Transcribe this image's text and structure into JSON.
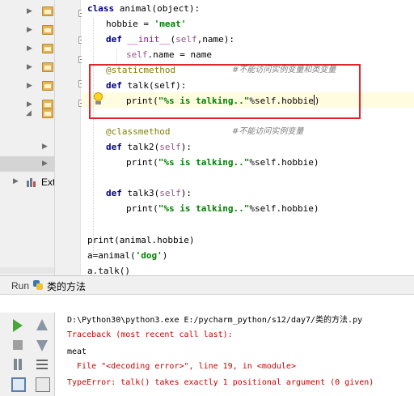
{
  "project_tree": {
    "folders": [
      "",
      "",
      "",
      "",
      "",
      "",
      ""
    ],
    "external_label": "Ext"
  },
  "colors": {
    "keyword": "#000080",
    "string": "#008000",
    "self": "#94558d",
    "decorator": "#808000",
    "comment": "#808080",
    "error": "#cc0000",
    "highlight_box": "#e0262a"
  },
  "editor": {
    "lines": [
      {
        "kw": "class ",
        "rest": "animal(object):"
      },
      {
        "name": "hobbie",
        "op": " = ",
        "str": "'meat'"
      },
      {
        "kw": "def ",
        "magic": "__init__",
        "open": "(",
        "self": "self",
        "rest": ",name):"
      },
      {
        "self": "self",
        "rest": ".name = name"
      },
      {
        "deco": "@staticmethod",
        "comment": "#不能访问实例变量和类变量"
      },
      {
        "kw": "def ",
        "rest": "talk(self):"
      },
      {
        "call": "print(",
        "str": "\"%s is talking..\"",
        "rest": "%self.hobbie",
        "close": ")"
      },
      {
        "deco": "@classmethod",
        "comment": "#不能访问实例变量"
      },
      {
        "kw": "def ",
        "rest": "talk2(",
        "self": "self",
        "close": "):"
      },
      {
        "call": "print(",
        "str": "\"%s is talking..\"",
        "rest": "%self.hobbie)"
      },
      {
        "kw": "def ",
        "rest": "talk3(",
        "self": "self",
        "close": "):"
      },
      {
        "call": "print(",
        "str": "\"%s is talking..\"",
        "rest": "%self.hobbie)"
      },
      {
        "rest": "print(animal.hobbie)"
      },
      {
        "pre": "a=animal(",
        "str": "'dog'",
        "close": ")"
      },
      {
        "rest": "a.talk()"
      }
    ]
  },
  "run_panel": {
    "title": "Run",
    "config_name": "类的方法",
    "console": [
      {
        "type": "cmd",
        "text": "D:\\Python30\\python3.exe E:/pycharm_python/s12/day7/类的方法.py"
      },
      {
        "type": "err",
        "text": "Traceback (most recent call last):"
      },
      {
        "type": "out",
        "text": "meat"
      },
      {
        "type": "err",
        "text": "  File \"<decoding error>\", line 19, in <module>"
      },
      {
        "type": "err",
        "text": "TypeError: talk() takes exactly 1 positional argument (0 given)"
      }
    ]
  }
}
